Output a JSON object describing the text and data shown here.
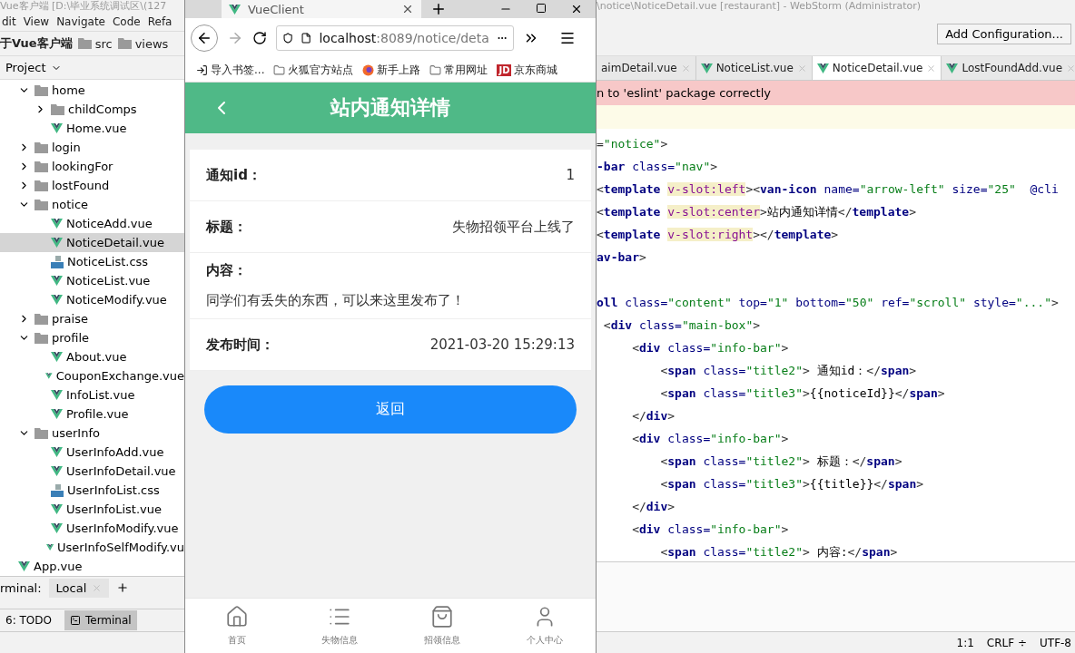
{
  "ide_left": {
    "title": "Vue客户端 [D:\\毕业系统调试区\\(127",
    "menu": [
      "dit",
      "View",
      "Navigate",
      "Code",
      "Refa"
    ],
    "breadcrumb": [
      "于Vue客户端",
      "src",
      "views"
    ],
    "project_label": "Project",
    "tree": [
      {
        "name": "home",
        "kind": "folder",
        "expanded": true,
        "selected": false,
        "children": [
          {
            "name": "childComps",
            "kind": "folder",
            "expanded": false,
            "selected": false
          },
          {
            "name": "Home.vue",
            "kind": "vue",
            "selected": false
          }
        ]
      },
      {
        "name": "login",
        "kind": "folder",
        "expanded": false,
        "selected": false
      },
      {
        "name": "lookingFor",
        "kind": "folder",
        "expanded": false,
        "selected": false
      },
      {
        "name": "lostFound",
        "kind": "folder",
        "expanded": false,
        "selected": false
      },
      {
        "name": "notice",
        "kind": "folder",
        "expanded": true,
        "selected": false,
        "children": [
          {
            "name": "NoticeAdd.vue",
            "kind": "vue",
            "selected": false
          },
          {
            "name": "NoticeDetail.vue",
            "kind": "vue",
            "selected": true
          },
          {
            "name": "NoticeList.css",
            "kind": "css",
            "selected": false
          },
          {
            "name": "NoticeList.vue",
            "kind": "vue",
            "selected": false
          },
          {
            "name": "NoticeModify.vue",
            "kind": "vue",
            "selected": false
          }
        ]
      },
      {
        "name": "praise",
        "kind": "folder",
        "expanded": false,
        "selected": false
      },
      {
        "name": "profile",
        "kind": "folder",
        "expanded": true,
        "selected": false,
        "children": [
          {
            "name": "About.vue",
            "kind": "vue",
            "selected": false
          },
          {
            "name": "CouponExchange.vue",
            "kind": "vue",
            "selected": false
          },
          {
            "name": "InfoList.vue",
            "kind": "vue",
            "selected": false
          },
          {
            "name": "Profile.vue",
            "kind": "vue",
            "selected": false
          }
        ]
      },
      {
        "name": "userInfo",
        "kind": "folder",
        "expanded": true,
        "selected": false,
        "children": [
          {
            "name": "UserInfoAdd.vue",
            "kind": "vue",
            "selected": false
          },
          {
            "name": "UserInfoDetail.vue",
            "kind": "vue",
            "selected": false
          },
          {
            "name": "UserInfoList.css",
            "kind": "css",
            "selected": false
          },
          {
            "name": "UserInfoList.vue",
            "kind": "vue",
            "selected": false
          },
          {
            "name": "UserInfoModify.vue",
            "kind": "vue",
            "selected": false
          },
          {
            "name": "UserInfoSelfModify.vu",
            "kind": "vue",
            "selected": false
          }
        ]
      }
    ],
    "tree_outer": [
      {
        "name": "App.vue",
        "kind": "vue",
        "selected": false
      }
    ],
    "terminal_label": "rminal:",
    "terminal_tabs": [
      {
        "label": "Local",
        "selected": true
      }
    ],
    "tool_tabs": [
      {
        "label": "6: TODO",
        "selected": false
      },
      {
        "label": "Terminal",
        "selected": true
      }
    ]
  },
  "browser": {
    "tab": {
      "title": "VueClient"
    },
    "url": {
      "host": "localhost",
      "path": ":8089/notice/deta"
    },
    "bookmarks": [
      {
        "label": "导入书签...",
        "kind": "import"
      },
      {
        "label": "火狐官方站点",
        "kind": "folder"
      },
      {
        "label": "新手上路",
        "kind": "firefox"
      },
      {
        "label": "常用网址",
        "kind": "folder"
      },
      {
        "label": "京东商城",
        "kind": "jd",
        "badge": "JD"
      }
    ]
  },
  "app": {
    "title": "站内通知详情",
    "fields": [
      {
        "kind": "pair",
        "label": "通知id：",
        "value": "1"
      },
      {
        "kind": "pair",
        "label": "标题：",
        "value": "失物招领平台上线了"
      },
      {
        "kind": "block",
        "label": "内容：",
        "value": "同学们有丢失的东西，可以来这里发布了！"
      },
      {
        "kind": "pair",
        "label": "发布时间：",
        "value": "2021-03-20 15:29:13"
      }
    ],
    "button": "返回",
    "tabbar": [
      {
        "label": "首页",
        "kind": "home",
        "selected": false
      },
      {
        "label": "失物信息",
        "kind": "list",
        "selected": false
      },
      {
        "label": "招领信息",
        "kind": "bag",
        "selected": false
      },
      {
        "label": "个人中心",
        "kind": "user",
        "selected": false
      }
    ]
  },
  "ide_right": {
    "title": "\\notice\\NoticeDetail.vue [restaurant] - WebStorm (Administrator)",
    "run_config": "Add Configuration...",
    "editor_tabs": [
      {
        "label": "aimDetail.vue",
        "selected": false
      },
      {
        "label": "NoticeList.vue",
        "selected": false
      },
      {
        "label": "NoticeDetail.vue",
        "selected": true
      },
      {
        "label": "LostFoundAdd.vue",
        "selected": false
      }
    ],
    "error_banner": "n to 'eslint' package correctly",
    "code_lines": [
      [
        {
          "kind": "punct",
          "text": "="
        },
        {
          "kind": "value",
          "text": "\"notice\""
        },
        {
          "kind": "punct",
          "text": ">"
        }
      ],
      [
        {
          "kind": "tag",
          "text": "-bar "
        },
        {
          "kind": "attr",
          "text": "class="
        },
        {
          "kind": "value",
          "text": "\"nav\""
        },
        {
          "kind": "punct",
          "text": ">"
        }
      ],
      [
        {
          "kind": "punct",
          "text": "<"
        },
        {
          "kind": "tag",
          "text": "template "
        },
        {
          "kind": "directive",
          "text": "v-slot:left"
        },
        {
          "kind": "punct",
          "text": "><"
        },
        {
          "kind": "tag",
          "text": "van-icon "
        },
        {
          "kind": "attr",
          "text": "name="
        },
        {
          "kind": "value",
          "text": "\"arrow-left\" "
        },
        {
          "kind": "attr",
          "text": "size="
        },
        {
          "kind": "value",
          "text": "\"25\"  "
        },
        {
          "kind": "attr",
          "text": "@cli"
        }
      ],
      [
        {
          "kind": "punct",
          "text": "<"
        },
        {
          "kind": "tag",
          "text": "template "
        },
        {
          "kind": "directive",
          "text": "v-slot:center"
        },
        {
          "kind": "punct",
          "text": ">"
        },
        {
          "kind": "text",
          "text": "站内通知详情"
        },
        {
          "kind": "punct",
          "text": "</"
        },
        {
          "kind": "tag",
          "text": "template"
        },
        {
          "kind": "punct",
          "text": ">"
        }
      ],
      [
        {
          "kind": "punct",
          "text": "<"
        },
        {
          "kind": "tag",
          "text": "template "
        },
        {
          "kind": "directive",
          "text": "v-slot:right"
        },
        {
          "kind": "punct",
          "text": "></"
        },
        {
          "kind": "tag",
          "text": "template"
        },
        {
          "kind": "punct",
          "text": ">"
        }
      ],
      [
        {
          "kind": "tag",
          "text": "av-bar"
        },
        {
          "kind": "punct",
          "text": ">"
        }
      ],
      {
        "blank_before": true,
        "tokens": [
          {
            "kind": "tag",
            "text": "oll "
          },
          {
            "kind": "attr",
            "text": "class="
          },
          {
            "kind": "value",
            "text": "\"content\" "
          },
          {
            "kind": "attr",
            "text": "top="
          },
          {
            "kind": "value",
            "text": "\"1\" "
          },
          {
            "kind": "attr",
            "text": "bottom="
          },
          {
            "kind": "value",
            "text": "\"50\" "
          },
          {
            "kind": "attr",
            "text": "ref="
          },
          {
            "kind": "value",
            "text": "\"scroll\" "
          },
          {
            "kind": "attr",
            "text": "style="
          },
          {
            "kind": "value",
            "text": "\"...\""
          },
          {
            "kind": "punct",
            "text": ">"
          }
        ]
      },
      [
        {
          "kind": "punct",
          "text": " <"
        },
        {
          "kind": "tag",
          "text": "div "
        },
        {
          "kind": "attr",
          "text": "class="
        },
        {
          "kind": "value",
          "text": "\"main-box\""
        },
        {
          "kind": "punct",
          "text": ">"
        }
      ],
      [
        {
          "kind": "punct",
          "text": "     <"
        },
        {
          "kind": "tag",
          "text": "div "
        },
        {
          "kind": "attr",
          "text": "class="
        },
        {
          "kind": "value",
          "text": "\"info-bar\""
        },
        {
          "kind": "punct",
          "text": ">"
        }
      ],
      [
        {
          "kind": "punct",
          "text": "         <"
        },
        {
          "kind": "tag",
          "text": "span "
        },
        {
          "kind": "attr",
          "text": "class="
        },
        {
          "kind": "value",
          "text": "\"title2\""
        },
        {
          "kind": "punct",
          "text": "> "
        },
        {
          "kind": "text",
          "text": "通知id："
        },
        {
          "kind": "punct",
          "text": "</"
        },
        {
          "kind": "tag",
          "text": "span"
        },
        {
          "kind": "punct",
          "text": ">"
        }
      ],
      [
        {
          "kind": "punct",
          "text": "         <"
        },
        {
          "kind": "tag",
          "text": "span "
        },
        {
          "kind": "attr",
          "text": "class="
        },
        {
          "kind": "value",
          "text": "\"title3\""
        },
        {
          "kind": "punct",
          "text": ">"
        },
        {
          "kind": "text",
          "text": "{{noticeId}}"
        },
        {
          "kind": "punct",
          "text": "</"
        },
        {
          "kind": "tag",
          "text": "span"
        },
        {
          "kind": "punct",
          "text": ">"
        }
      ],
      [
        {
          "kind": "punct",
          "text": "     </"
        },
        {
          "kind": "tag",
          "text": "div"
        },
        {
          "kind": "punct",
          "text": ">"
        }
      ],
      [
        {
          "kind": "punct",
          "text": "     <"
        },
        {
          "kind": "tag",
          "text": "div "
        },
        {
          "kind": "attr",
          "text": "class="
        },
        {
          "kind": "value",
          "text": "\"info-bar\""
        },
        {
          "kind": "punct",
          "text": ">"
        }
      ],
      [
        {
          "kind": "punct",
          "text": "         <"
        },
        {
          "kind": "tag",
          "text": "span "
        },
        {
          "kind": "attr",
          "text": "class="
        },
        {
          "kind": "value",
          "text": "\"title2\""
        },
        {
          "kind": "punct",
          "text": "> "
        },
        {
          "kind": "text",
          "text": "标题："
        },
        {
          "kind": "punct",
          "text": "</"
        },
        {
          "kind": "tag",
          "text": "span"
        },
        {
          "kind": "punct",
          "text": ">"
        }
      ],
      [
        {
          "kind": "punct",
          "text": "         <"
        },
        {
          "kind": "tag",
          "text": "span "
        },
        {
          "kind": "attr",
          "text": "class="
        },
        {
          "kind": "value",
          "text": "\"title3\""
        },
        {
          "kind": "punct",
          "text": ">"
        },
        {
          "kind": "text",
          "text": "{{title}}"
        },
        {
          "kind": "punct",
          "text": "</"
        },
        {
          "kind": "tag",
          "text": "span"
        },
        {
          "kind": "punct",
          "text": ">"
        }
      ],
      [
        {
          "kind": "punct",
          "text": "     </"
        },
        {
          "kind": "tag",
          "text": "div"
        },
        {
          "kind": "punct",
          "text": ">"
        }
      ],
      [
        {
          "kind": "punct",
          "text": "     <"
        },
        {
          "kind": "tag",
          "text": "div "
        },
        {
          "kind": "attr",
          "text": "class="
        },
        {
          "kind": "value",
          "text": "\"info-bar\""
        },
        {
          "kind": "punct",
          "text": ">"
        }
      ],
      [
        {
          "kind": "punct",
          "text": "         <"
        },
        {
          "kind": "tag",
          "text": "span "
        },
        {
          "kind": "attr",
          "text": "class="
        },
        {
          "kind": "value",
          "text": "\"title2\""
        },
        {
          "kind": "punct",
          "text": "> "
        },
        {
          "kind": "text",
          "text": "内容:"
        },
        {
          "kind": "punct",
          "text": "</"
        },
        {
          "kind": "tag",
          "text": "span"
        },
        {
          "kind": "punct",
          "text": ">"
        }
      ]
    ],
    "status": [
      "1:1",
      "CRLF ÷",
      "UTF-8"
    ]
  }
}
